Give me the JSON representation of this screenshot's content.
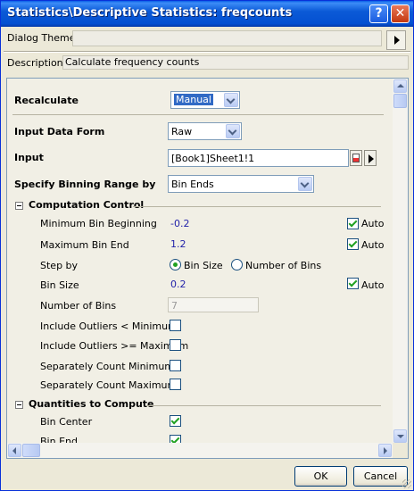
{
  "window": {
    "title": "Statistics\\Descriptive Statistics: freqcounts"
  },
  "titlebar": {
    "help_label": "?",
    "close_label": "✕"
  },
  "header": {
    "dialog_theme_label": "Dialog Theme",
    "dialog_theme_value": "",
    "description_label": "Description",
    "description_value": "Calculate frequency counts"
  },
  "settings": {
    "recalculate": {
      "label": "Recalculate",
      "value": "Manual"
    },
    "input_data_form": {
      "label": "Input Data Form",
      "value": "Raw"
    },
    "input": {
      "label": "Input",
      "value": "[Book1]Sheet1!1"
    },
    "binning_range": {
      "label": "Specify Binning Range by",
      "value": "Bin Ends"
    }
  },
  "computation_control": {
    "title": "Computation Control",
    "min_bin_beginning": {
      "label": "Minimum Bin Beginning",
      "value": "-0.2",
      "auto_label": "Auto",
      "auto": true
    },
    "max_bin_end": {
      "label": "Maximum Bin End",
      "value": "1.2",
      "auto_label": "Auto",
      "auto": true
    },
    "step_by": {
      "label": "Step by",
      "options": [
        "Bin Size",
        "Number of Bins"
      ],
      "selected": "Bin Size"
    },
    "bin_size": {
      "label": "Bin Size",
      "value": "0.2",
      "auto_label": "Auto",
      "auto": true
    },
    "number_of_bins": {
      "label": "Number of Bins",
      "value": "7"
    },
    "include_outliers_lt_min": {
      "label": "Include Outliers < Minimum",
      "checked": false
    },
    "include_outliers_ge_max": {
      "label": "Include Outliers >= Maximum",
      "checked": false
    },
    "separately_count_min": {
      "label": "Separately Count Minimum",
      "checked": false
    },
    "separately_count_max": {
      "label": "Separately Count Maximum",
      "checked": false
    }
  },
  "quantities": {
    "title": "Quantities to Compute",
    "bin_center": {
      "label": "Bin Center",
      "checked": true
    },
    "bin_end": {
      "label": "Bin End",
      "checked": true
    }
  },
  "footer": {
    "ok_label": "OK",
    "cancel_label": "Cancel"
  },
  "colors": {
    "title_bar": "#0450d1",
    "value_text": "#1f1fa8",
    "check_mark": "#21a121",
    "panel_bg": "#f1efe5"
  },
  "icons": [
    "help-icon",
    "close-icon",
    "theme-menu-arrow-icon",
    "collapse-toggle-icon",
    "dropdown-chevron-icon",
    "browse-range-icon",
    "scroll-up-icon",
    "scroll-down-icon",
    "scroll-left-icon",
    "scroll-right-icon"
  ]
}
